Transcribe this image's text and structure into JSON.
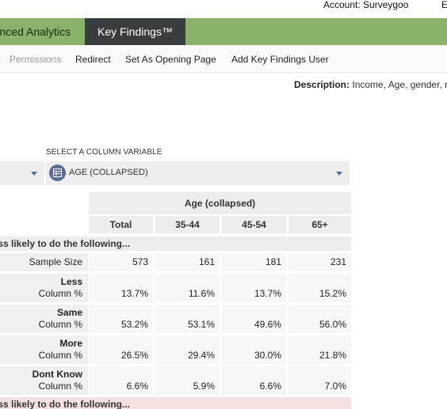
{
  "header": {
    "account_label": "Account: Surveygoo",
    "account_extra": "E"
  },
  "tabs": {
    "advanced": "nced Analytics",
    "key_findings": "Key Findings™"
  },
  "submenu": {
    "permissions": "Permissions",
    "redirect": "Redirect",
    "set_opening": "Set As Opening Page",
    "add_user": "Add Key Findings User"
  },
  "description": {
    "label": "Description:",
    "text": "Income, Age, gender, r"
  },
  "column_selector": {
    "label": "SELECT A COLUMN VARIABLE",
    "value": "AGE (COLLAPSED)",
    "icon": "table-icon",
    "accent": "#4d6fa8"
  },
  "table": {
    "group_header": "Age (collapsed)",
    "columns": [
      "Total",
      "35-44",
      "45-54",
      "65+"
    ],
    "section_top": "ss likely to do the following...",
    "section_bottom": "ess likely to do the following...",
    "sample_size": {
      "label": "Sample Size",
      "values": [
        "573",
        "161",
        "181",
        "231"
      ]
    },
    "rows": [
      {
        "title": "Less",
        "sub": "Column %",
        "values": [
          "13.7%",
          "11.6%",
          "13.7%",
          "15.2%"
        ]
      },
      {
        "title": "Same",
        "sub": "Column %",
        "values": [
          "53.2%",
          "53.1%",
          "49.6%",
          "56.0%"
        ]
      },
      {
        "title": "More",
        "sub": "Column %",
        "values": [
          "26.5%",
          "29.4%",
          "30.0%",
          "21.8%"
        ]
      },
      {
        "title": "Dont Know",
        "sub": "Column %",
        "values": [
          "6.6%",
          "5.9%",
          "6.6%",
          "7.0%"
        ]
      }
    ]
  },
  "colors": {
    "tab_bar": "#8ab26a",
    "active_tab": "#3a3d40",
    "section_top_bg": "#ededed",
    "section_bottom_bg": "#f6e1e1"
  }
}
